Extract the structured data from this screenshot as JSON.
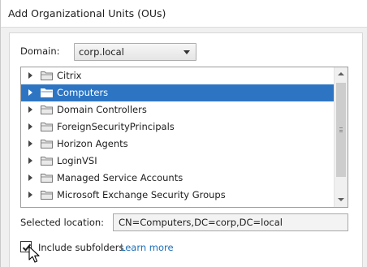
{
  "dialog": {
    "title": "Add Organizational Units (OUs)"
  },
  "domain": {
    "label": "Domain:",
    "selected": "corp.local"
  },
  "tree": {
    "items": [
      {
        "label": "Citrix",
        "selected": false
      },
      {
        "label": "Computers",
        "selected": true
      },
      {
        "label": "Domain Controllers",
        "selected": false
      },
      {
        "label": "ForeignSecurityPrincipals",
        "selected": false
      },
      {
        "label": "Horizon Agents",
        "selected": false
      },
      {
        "label": "LoginVSI",
        "selected": false
      },
      {
        "label": "Managed Service Accounts",
        "selected": false
      },
      {
        "label": "Microsoft Exchange Security Groups",
        "selected": false
      }
    ]
  },
  "selected_location": {
    "label": "Selected location:",
    "value": "CN=Computers,DC=corp,DC=local"
  },
  "subfolders": {
    "label": "Include subfolders",
    "checked": true,
    "link": "Learn more"
  },
  "colors": {
    "selection": "#2d75c3",
    "link": "#1d6fb8",
    "folder_fill": "#e9e9e9",
    "folder_stroke": "#7a7a7a"
  }
}
